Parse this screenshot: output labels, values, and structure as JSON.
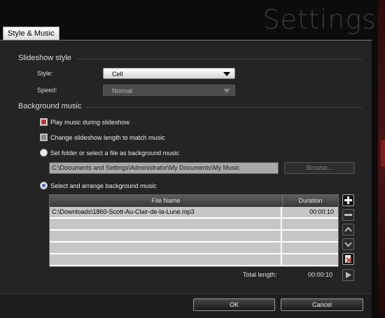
{
  "window": {
    "title": "Settings"
  },
  "tabs": [
    {
      "label": "Style & Music"
    }
  ],
  "slideshow_style": {
    "header": "Slideshow style",
    "style_label": "Style:",
    "style_value": "Cell",
    "speed_label": "Speed:",
    "speed_value": "Normal"
  },
  "background_music": {
    "header": "Background music",
    "play_music": {
      "label": "Play music during slideshow",
      "checked": true
    },
    "change_length": {
      "label": "Change slideshow length to match music",
      "checked": false
    },
    "folder_option": {
      "label": "Set folder or select a file as background music",
      "selected": false
    },
    "folder_path": "C:\\Documents and Settings\\Administrator\\My Documents\\My Music",
    "browse_label": "Browse...",
    "arrange_option": {
      "label": "Select and arrange background music",
      "selected": true
    },
    "table": {
      "columns": [
        "File Name",
        "Duration"
      ],
      "rows": [
        [
          "C:\\Downloads\\1860-Scott-Au-Clair-de-la-Lune.mp3",
          "00:00:10"
        ],
        [
          "",
          ""
        ],
        [
          "",
          ""
        ],
        [
          "",
          ""
        ],
        [
          "",
          ""
        ]
      ]
    },
    "side_buttons": [
      "add-icon",
      "remove-icon",
      "move-up-icon",
      "move-down-icon",
      "delete-all-icon",
      "play-icon"
    ],
    "total_label": "Total length:",
    "total_value": "00:00:10"
  },
  "footer": {
    "ok_label": "OK",
    "cancel_label": "Cancel"
  },
  "colors": {
    "panel": "#242424",
    "accent_red": "#c0392b",
    "radio_blue": "#2f6fc9"
  }
}
